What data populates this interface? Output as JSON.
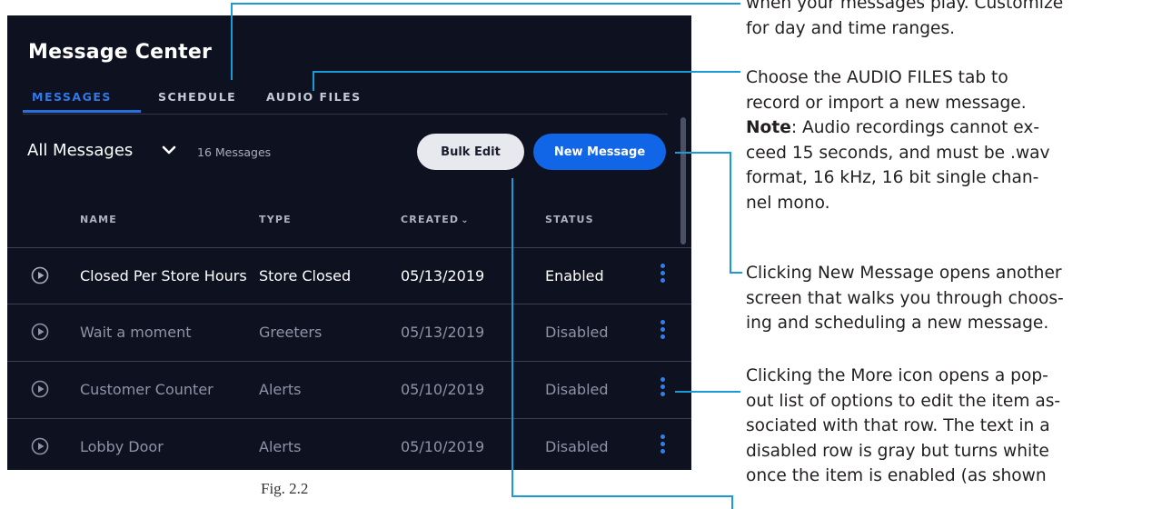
{
  "panel": {
    "title": "Message Center",
    "tabs": [
      {
        "label": "MESSAGES",
        "active": true
      },
      {
        "label": "SCHEDULE",
        "active": false
      },
      {
        "label": "AUDIO FILES",
        "active": false
      }
    ],
    "filter_label": "All Messages",
    "message_count": "16 Messages",
    "bulk_edit_label": "Bulk Edit",
    "new_message_label": "New Message",
    "columns": {
      "name": "NAME",
      "type": "TYPE",
      "created": "CREATED",
      "status": "STATUS"
    },
    "rows": [
      {
        "name": "Closed Per Store Hours",
        "type": "Store Closed",
        "created": "05/13/2019",
        "status": "Enabled"
      },
      {
        "name": "Wait a moment",
        "type": "Greeters",
        "created": "05/13/2019",
        "status": "Disabled"
      },
      {
        "name": "Customer Counter",
        "type": "Alerts",
        "created": "05/10/2019",
        "status": "Disabled"
      },
      {
        "name": "Lobby Door",
        "type": "Alerts",
        "created": "05/10/2019",
        "status": "Disabled"
      }
    ]
  },
  "caption": "Fig. 2.2",
  "callouts": {
    "c1": [
      "when your messages play. Customize",
      "for day and time ranges."
    ],
    "c2_lines": [
      "Choose the AUDIO FILES tab to",
      "record or import a new message."
    ],
    "c2_note_label": "Note",
    "c2_note_lines": [
      ": Audio recordings cannot ex-",
      "ceed 15 seconds, and must be .wav",
      "format, 16 kHz, 16 bit single chan-",
      "nel mono."
    ],
    "c3": [
      "Clicking New Message opens another",
      "screen that walks you through choos-",
      "ing and scheduling a new message."
    ],
    "c4": [
      "Clicking the More icon opens a pop-",
      "out list of options to edit the item as-",
      "sociated with that row. The text in a",
      "disabled row is gray but turns white",
      "once the item is enabled (as shown"
    ]
  },
  "colors": {
    "panel_bg": "#0d1120",
    "accent_blue": "#1166e8",
    "leader_line": "#1a9bd7",
    "disabled_text": "#8e94a6"
  }
}
